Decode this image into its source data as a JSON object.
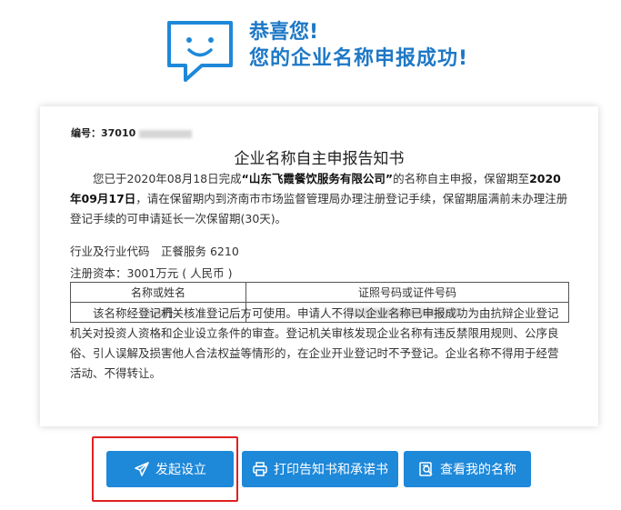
{
  "header": {
    "line1": "恭喜您!",
    "line2": "您的企业名称申报成功!",
    "icon": "chat-bubble-smile-icon",
    "accent": "#1E78C6"
  },
  "notice": {
    "serial_label": "编号：37010",
    "title": "企业名称自主申报告知书",
    "para1_a": "您已于2020年08月18日完成",
    "para1_company": "“山东飞霞餐饮服务有限公司”",
    "para1_b": "的名称自主申报，保留期至",
    "para1_date": "2020年09月17日",
    "para1_c": "，请在保留期内到济南市市场监督管理局办理注册登记手续，保留期届满前未办理注册登记手续的可申请延长一次保留期(30天)。",
    "industry": "行业及行业代码　正餐服务 6210",
    "capital": "注册资本：3001万元 ( 人民币 )",
    "table": {
      "headers": [
        "名称或姓名",
        "证照号码或证件号码"
      ],
      "row_name_visible": "丹"
    },
    "para2": "该名称经登记机关核准登记后方可使用。申请人不得以企业名称已申报成功为由抗辩企业登记机关对投资人资格和企业设立条件的审查。登记机关审核发现企业名称有违反禁限用规则、公序良俗、引人误解及损害他人合法权益等情形的，在企业开业登记时不予登记。企业名称不得用于经营活动、不得转让。"
  },
  "buttons": {
    "start": "发起设立",
    "print": "打印告知书和承诺书",
    "view": "查看我的名称",
    "color": "#1E88D9"
  }
}
